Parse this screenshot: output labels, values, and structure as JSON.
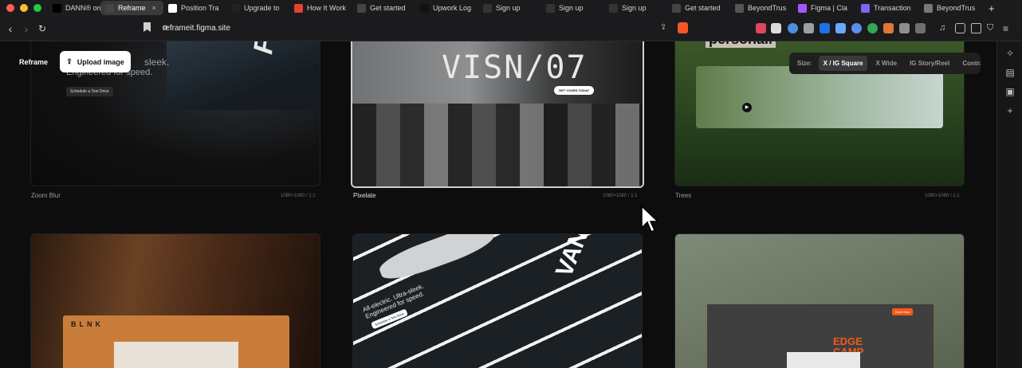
{
  "browser": {
    "tabs": [
      {
        "label": "DANN® on",
        "icon": "x-logo-icon",
        "color": "#000000"
      },
      {
        "label": "Reframe",
        "icon": "globe-icon",
        "color": "#444444",
        "active": true
      },
      {
        "label": "Position Tra",
        "icon": "gmail-icon",
        "color": "#ffffff"
      },
      {
        "label": "Upgrade to",
        "icon": "upgrade-icon",
        "color": "#222222"
      },
      {
        "label": "How It Work",
        "icon": "red-app-icon",
        "color": "#e0462f"
      },
      {
        "label": "Get started",
        "icon": "globe-icon",
        "color": "#444444"
      },
      {
        "label": "Upwork Log",
        "icon": "upwork-icon",
        "color": "#111111"
      },
      {
        "label": "Sign up",
        "icon": "sparkle-icon",
        "color": "#333333"
      },
      {
        "label": "Sign up",
        "icon": "sparkle-icon",
        "color": "#333333"
      },
      {
        "label": "Sign up",
        "icon": "sparkle-icon",
        "color": "#333333"
      },
      {
        "label": "Get started",
        "icon": "globe-icon",
        "color": "#444444"
      },
      {
        "label": "BeyondTrus",
        "icon": "beyondtrust-icon",
        "color": "#555555"
      },
      {
        "label": "Figma | Cla",
        "icon": "figma-icon",
        "color": "#a259ff"
      },
      {
        "label": "Transaction",
        "icon": "transaction-icon",
        "color": "#7b68ee"
      },
      {
        "label": "BeyondTrus",
        "icon": "page-icon",
        "color": "#777777"
      }
    ],
    "url": "reframeit.figma.site"
  },
  "app": {
    "title": "Reframe",
    "upload_label": "Upload image",
    "size_label": "Size:",
    "size_options": [
      "X / IG Square",
      "X Wide",
      "IG Story/Reel",
      "Contra"
    ],
    "size_active": "X / IG Square"
  },
  "cards": [
    {
      "label": "Zoom Blur",
      "meta": "1080×1080 / 1:1",
      "headline": "sleek.",
      "headline2": "Engineered for speed.",
      "cta": "Schedule a Test Drive",
      "brand": "FAST"
    },
    {
      "label": "Pixelate",
      "meta": "1080×1080 / 1:1",
      "headline": "VISN/07",
      "cta": "GET YOURS TODAY"
    },
    {
      "label": "Trees",
      "meta": "1080×1080 / 1:1",
      "headline": "personal."
    },
    {
      "label": "",
      "meta": "",
      "brand": "BLNK"
    },
    {
      "label": "",
      "meta": "",
      "headline": "All-electric. Ultra-sleek. Engineered for speed.",
      "cta": "Schedule a Test Drive",
      "brand": "VANTA"
    },
    {
      "label": "",
      "meta": "",
      "brand": "EDGE CAMP",
      "cta": "Book Now"
    }
  ]
}
